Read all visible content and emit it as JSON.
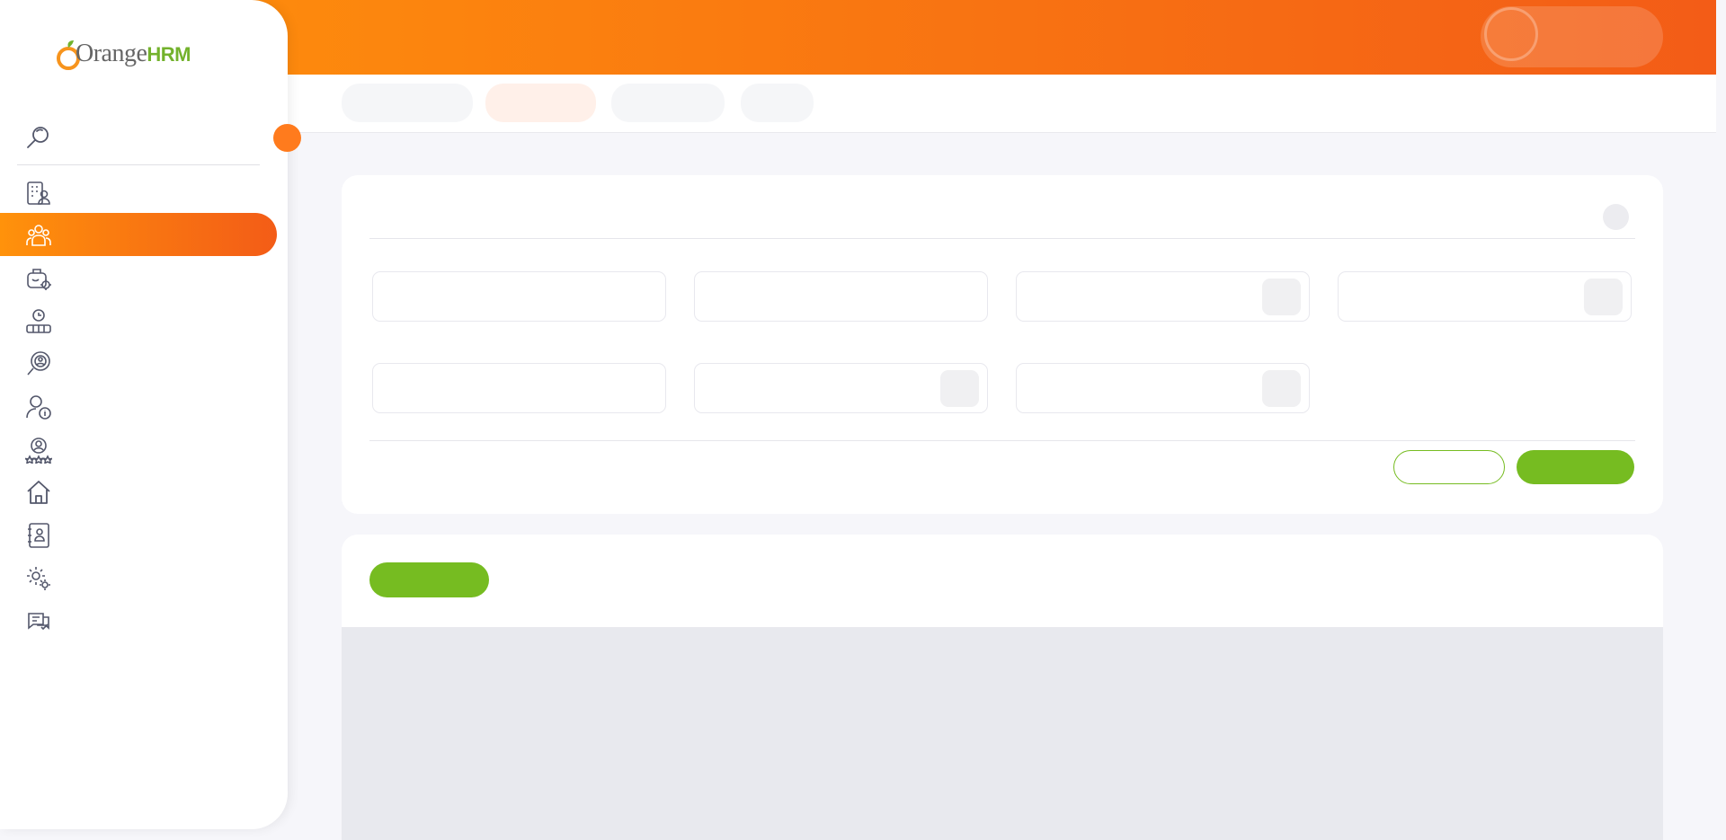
{
  "brand": {
    "logo_text": "Orange",
    "logo_suffix": "HRM"
  },
  "header": {
    "user_name": "",
    "accent": "#ff920b",
    "accent_end": "#f35c17"
  },
  "topnav": {
    "tabs": [
      {
        "label": "",
        "active": false
      },
      {
        "label": "",
        "active": true
      },
      {
        "label": "",
        "active": false
      },
      {
        "label": "",
        "active": false
      }
    ]
  },
  "sidebar": {
    "active_index": 1,
    "items": [
      {
        "icon": "admin-icon",
        "label": ""
      },
      {
        "icon": "pim-icon",
        "label": ""
      },
      {
        "icon": "leave-icon",
        "label": ""
      },
      {
        "icon": "time-icon",
        "label": ""
      },
      {
        "icon": "recruitment-icon",
        "label": ""
      },
      {
        "icon": "my-info-icon",
        "label": ""
      },
      {
        "icon": "performance-icon",
        "label": ""
      },
      {
        "icon": "dashboard-icon",
        "label": ""
      },
      {
        "icon": "directory-icon",
        "label": ""
      },
      {
        "icon": "maintenance-icon",
        "label": ""
      },
      {
        "icon": "buzz-icon",
        "label": ""
      }
    ]
  },
  "filter": {
    "title": "",
    "fields": [
      {
        "label": "",
        "value": "",
        "type": "text"
      },
      {
        "label": "",
        "value": "",
        "type": "text"
      },
      {
        "label": "",
        "value": "",
        "type": "select"
      },
      {
        "label": "",
        "value": "",
        "type": "select"
      },
      {
        "label": "",
        "value": "",
        "type": "text"
      },
      {
        "label": "",
        "value": "",
        "type": "select"
      },
      {
        "label": "",
        "value": "",
        "type": "select"
      }
    ],
    "reset_label": "",
    "search_label": ""
  },
  "list": {
    "add_label": ""
  },
  "colors": {
    "primary_green": "#76bc21",
    "brand_orange": "#ff7b1d"
  }
}
